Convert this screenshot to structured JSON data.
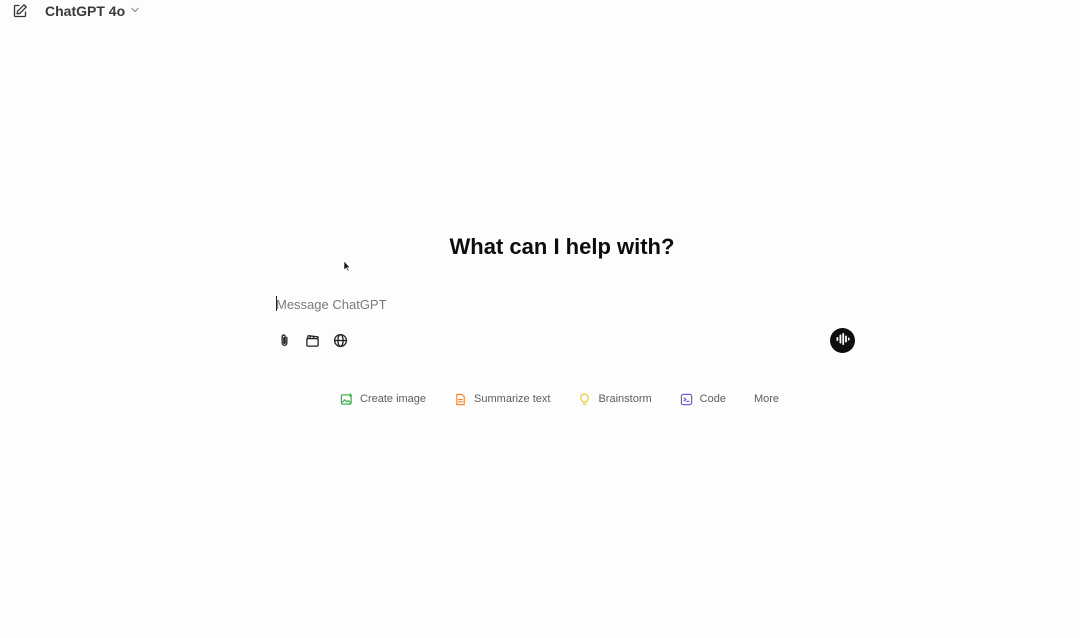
{
  "topbar": {
    "new_chat_icon": "new-chat-icon",
    "model_name": "ChatGPT 4o",
    "model_chevron_icon": "chevron-down-icon"
  },
  "main": {
    "heading": "What can I help with?"
  },
  "composer": {
    "placeholder": "Message ChatGPT",
    "value": "",
    "tools": [
      {
        "name": "attach",
        "icon": "paperclip-icon"
      },
      {
        "name": "video",
        "icon": "clapperboard-icon"
      },
      {
        "name": "search-web",
        "icon": "globe-icon"
      }
    ],
    "voice_icon": "voice-waveform-icon"
  },
  "suggestions": [
    {
      "label": "Create image",
      "icon": "image-icon",
      "color": "#3fb34f"
    },
    {
      "label": "Summarize text",
      "icon": "document-icon",
      "color": "#ef8a3c"
    },
    {
      "label": "Brainstorm",
      "icon": "lightbulb-icon",
      "color": "#e8c93a"
    },
    {
      "label": "Code",
      "icon": "code-icon",
      "color": "#6b63d6"
    },
    {
      "label": "More",
      "icon": "",
      "color": "#5d5d5d"
    }
  ]
}
